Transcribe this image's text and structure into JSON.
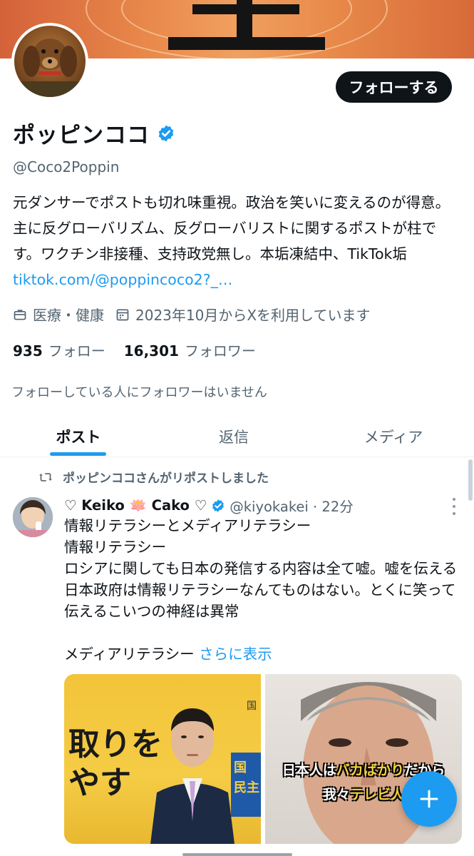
{
  "profile": {
    "display_name": "ポッピンココ",
    "handle": "@Coco2Poppin",
    "follow_label": "フォローする",
    "bio_text": "元ダンサーでポストも切れ味重視。政治を笑いに変えるのが得意。主に反グローバリズム、反グローバリストに関するポストが柱です。ワクチン非接種、支持政党無し。本垢凍結中、TikTok垢 ",
    "bio_link": "tiktok.com/@poppincoco2?_…",
    "category": "医療・健康",
    "joined": "2023年10月からXを利用しています",
    "following_count": "935",
    "following_label": "フォロー",
    "followers_count": "16,301",
    "followers_label": "フォロワー",
    "no_mutual_followers": "フォローしている人にフォロワーはいません"
  },
  "tabs": [
    {
      "label": "ポスト",
      "active": true
    },
    {
      "label": "返信",
      "active": false
    },
    {
      "label": "メディア",
      "active": false
    }
  ],
  "post": {
    "repost_note": "ポッピンココさんがリポストしました",
    "author_name": "♡ Keiko 🪷 Cako ♡",
    "author_handle_time": "@kiyokakei · 22分",
    "body": "情報リテラシーとメディアリテラシー\n情報リテラシー\nロシアに関しても日本の発信する内容は全て嘘。嘘を伝える日本政府は情報リテラシーなんてものはない。とくに笑って伝えるこいつの神経は異常\n\nメディアリテラシー ",
    "show_more": "さらに表示",
    "image1_text": "取りを\nやす",
    "image2_caption_white1": "日本人は",
    "image2_caption_yellow": "バカばかり",
    "image2_caption_white2": "だから",
    "image2_caption_line2_white": "我々",
    "image2_caption_line2_yellow": "テレビ人",
    "image1_corner_glyph": "国",
    "image1_side_text": "国\n民主"
  },
  "icons": {
    "verified": "verified-badge-icon",
    "briefcase": "briefcase-icon",
    "calendar": "calendar-icon",
    "repost": "repost-icon",
    "more": "more-vertical-icon",
    "compose": "plus-icon"
  },
  "colors": {
    "accent": "#1d9bf0",
    "text": "#0f1419",
    "secondary": "#536471"
  }
}
